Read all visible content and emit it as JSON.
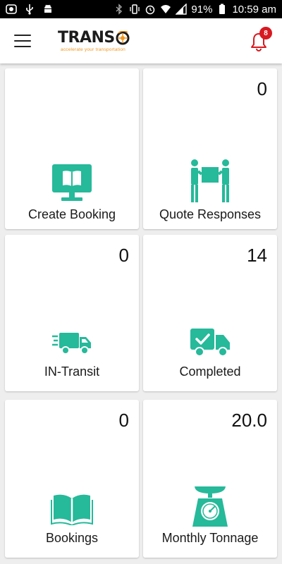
{
  "statusbar": {
    "battery": "91%",
    "time": "10:59 am"
  },
  "appbar": {
    "logo_text": "TRANS",
    "logo_tagline": "accelerate your transportation",
    "notification_count": "8"
  },
  "colors": {
    "accent": "#26b99a",
    "badge": "#d71920",
    "logo_orange": "#f2961d"
  },
  "tiles": [
    {
      "label": "Create Booking",
      "count": "",
      "icon": "monitor-book-icon"
    },
    {
      "label": "Quote Responses",
      "count": "0",
      "icon": "people-carrying-box-icon"
    },
    {
      "label": "IN-Transit",
      "count": "0",
      "icon": "fast-truck-icon"
    },
    {
      "label": "Completed",
      "count": "14",
      "icon": "truck-check-icon"
    },
    {
      "label": "Bookings",
      "count": "0",
      "icon": "open-book-icon"
    },
    {
      "label": "Monthly Tonnage",
      "count": "20.0",
      "icon": "weighing-scale-icon"
    }
  ]
}
